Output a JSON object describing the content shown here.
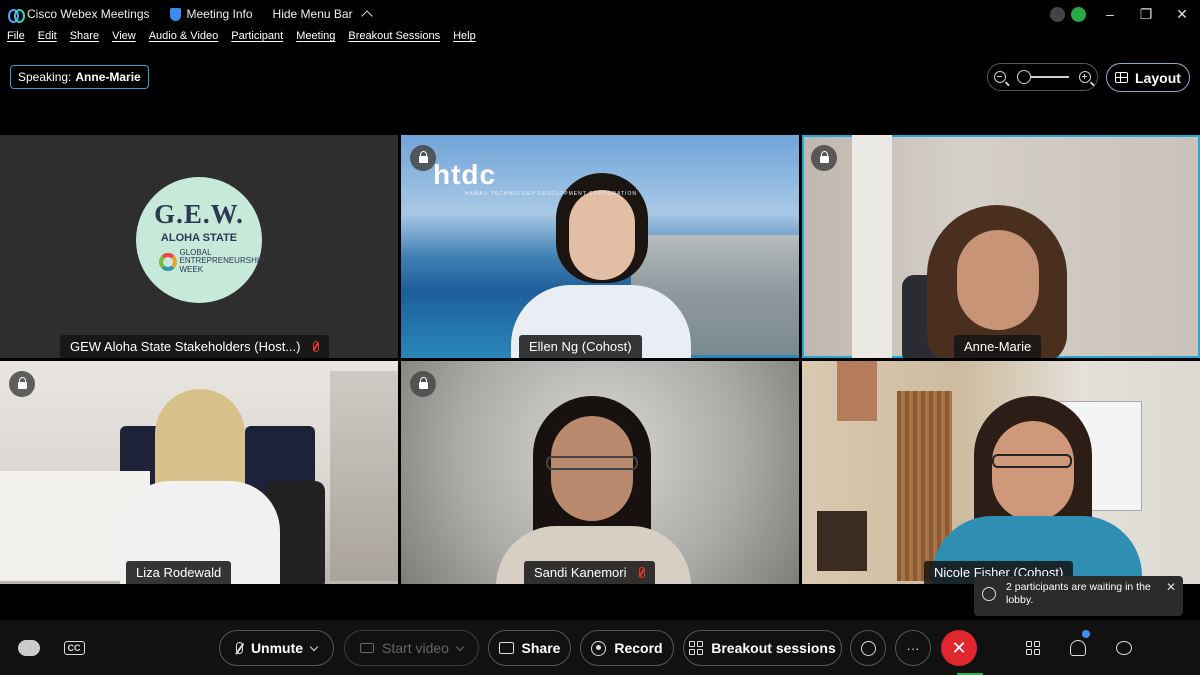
{
  "titlebar": {
    "app_name": "Cisco Webex Meetings",
    "meeting_info": "Meeting Info",
    "hide_menu": "Hide Menu Bar",
    "minimize": "–",
    "maximize": "❐",
    "close": "✕"
  },
  "menu": {
    "items": [
      "File",
      "Edit",
      "Share",
      "View",
      "Audio & Video",
      "Participant",
      "Meeting",
      "Breakout Sessions",
      "Help"
    ]
  },
  "speaking": {
    "label": "Speaking:",
    "name": "Anne-Marie"
  },
  "layout": {
    "label": "Layout"
  },
  "zoom": {
    "level": 0
  },
  "tiles": [
    {
      "name": "GEW Aloha State Stakeholders  (Host...)",
      "muted": true,
      "logo": {
        "title": "G.E.W.",
        "subtitle": "ALOHA STATE",
        "tag": "GLOBAL ENTREPRENEURSHIP WEEK"
      }
    },
    {
      "name": "Ellen Ng  (Cohost)",
      "muted": false,
      "banner": "htdc",
      "banner_sub": "HAWAII TECHNOLOGY DEVELOPMENT CORPORATION"
    },
    {
      "name": "Anne-Marie",
      "muted": false,
      "active": true
    },
    {
      "name": "Liza Rodewald",
      "muted": false
    },
    {
      "name": "Sandi Kanemori",
      "muted": true
    },
    {
      "name": "Nicole Fisher  (Cohost)",
      "muted": false
    }
  ],
  "toast": {
    "text": "2 participants are waiting in the lobby.",
    "close": "✕"
  },
  "controls": {
    "unmute": "Unmute",
    "start_video": "Start video",
    "share": "Share",
    "record": "Record",
    "breakout": "Breakout sessions",
    "cc": "CC",
    "more": "···",
    "end": "✕"
  },
  "colors": {
    "accent": "#25a7d9",
    "end_call": "#e0262f",
    "muted": "#ee3333",
    "notification": "#3a8ef0"
  }
}
